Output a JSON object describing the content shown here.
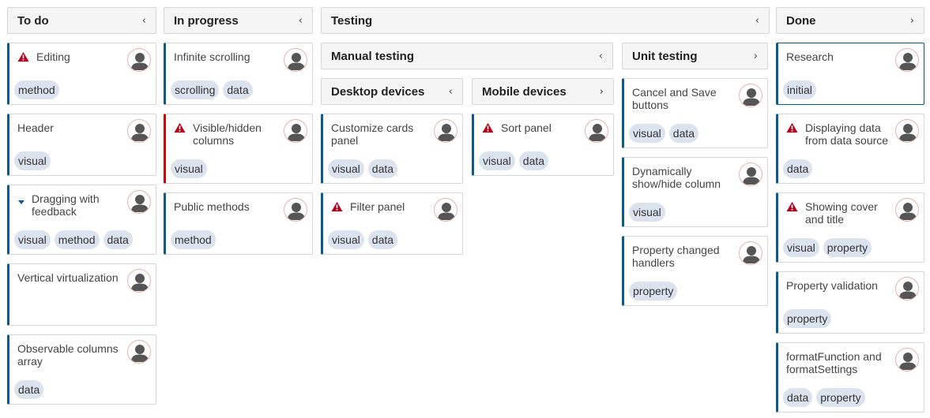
{
  "columns": {
    "todo": {
      "label": "To do",
      "chevron": "‹"
    },
    "inprogress": {
      "label": "In progress",
      "chevron": "‹"
    },
    "testing": {
      "label": "Testing",
      "chevron": "‹"
    },
    "done": {
      "label": "Done",
      "chevron": "›"
    }
  },
  "subcolumns": {
    "manual": {
      "label": "Manual testing",
      "chevron": "‹"
    },
    "unit": {
      "label": "Unit testing",
      "chevron": "›"
    },
    "desktop": {
      "label": "Desktop devices",
      "chevron": "‹"
    },
    "mobile": {
      "label": "Mobile devices",
      "chevron": "›"
    }
  },
  "cards": {
    "editing": {
      "title": "Editing",
      "tags": [
        "method"
      ]
    },
    "header": {
      "title": "Header",
      "tags": [
        "visual"
      ]
    },
    "dragging": {
      "title": "Dragging with feedback",
      "tags": [
        "visual",
        "method",
        "data"
      ]
    },
    "vertical": {
      "title": "Vertical virtualization",
      "tags": []
    },
    "observable": {
      "title": "Observable columns array",
      "tags": [
        "data"
      ]
    },
    "infinite": {
      "title": "Infinite scrolling",
      "tags": [
        "scrolling",
        "data"
      ]
    },
    "visiblehidden": {
      "title": "Visible/hidden columns",
      "tags": [
        "visual"
      ]
    },
    "publicmethods": {
      "title": "Public methods",
      "tags": [
        "method"
      ]
    },
    "customize": {
      "title": "Customize cards panel",
      "tags": [
        "visual",
        "data"
      ]
    },
    "filter": {
      "title": "Filter panel",
      "tags": [
        "visual",
        "data"
      ]
    },
    "sort": {
      "title": "Sort panel",
      "tags": [
        "visual",
        "data"
      ]
    },
    "cancelsave": {
      "title": "Cancel and Save buttons",
      "tags": [
        "visual",
        "data"
      ]
    },
    "dynamic": {
      "title": "Dynamically show/hide column",
      "tags": [
        "visual"
      ]
    },
    "propchanged": {
      "title": "Property changed handlers",
      "tags": [
        "property"
      ]
    },
    "research": {
      "title": "Research",
      "tags": [
        "initial"
      ]
    },
    "displaying": {
      "title": "Displaying data from data source",
      "tags": [
        "data"
      ]
    },
    "showing": {
      "title": "Showing cover and title",
      "tags": [
        "visual",
        "property"
      ]
    },
    "propvalidation": {
      "title": "Property validation",
      "tags": [
        "property"
      ]
    },
    "formatfn": {
      "title": "formatFunction and formatSettings",
      "tags": [
        "data",
        "property"
      ]
    }
  },
  "colors": {
    "accent": "#0a5a8e",
    "warning": "#b3001b",
    "red_border": "#e00000",
    "tag_bg": "#dbe4ee"
  }
}
